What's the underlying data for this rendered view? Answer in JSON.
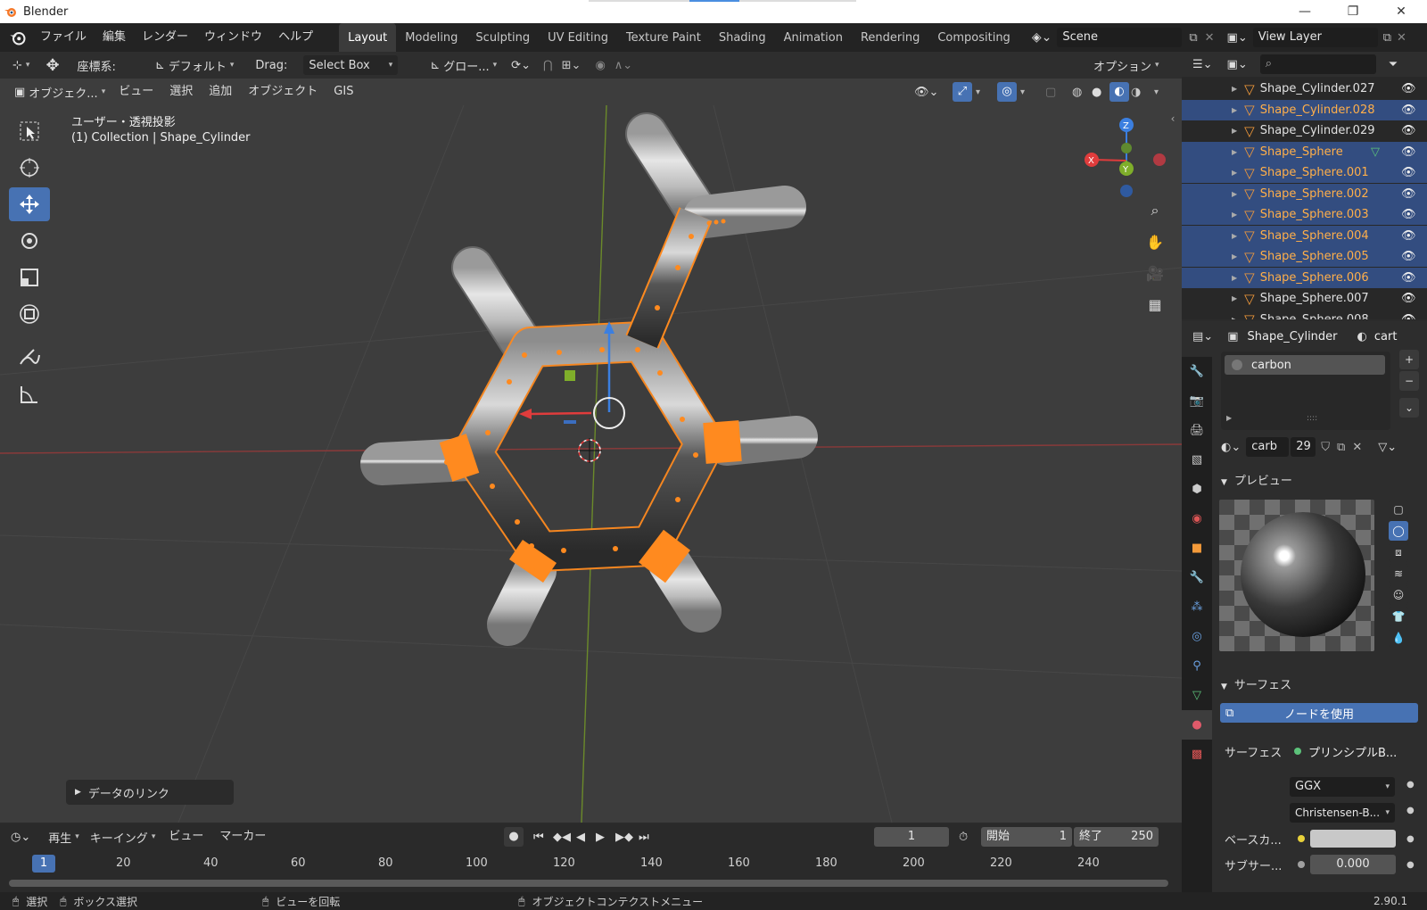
{
  "window": {
    "title": "Blender"
  },
  "menu": [
    "ファイル",
    "編集",
    "レンダー",
    "ウィンドウ",
    "ヘルプ"
  ],
  "workspaces": [
    {
      "label": "Layout",
      "active": true
    },
    {
      "label": "Modeling"
    },
    {
      "label": "Sculpting"
    },
    {
      "label": "UV Editing"
    },
    {
      "label": "Texture Paint"
    },
    {
      "label": "Shading"
    },
    {
      "label": "Animation"
    },
    {
      "label": "Rendering"
    },
    {
      "label": "Compositing"
    }
  ],
  "scene": {
    "name": "Scene"
  },
  "view_layer": {
    "name": "View Layer"
  },
  "header": {
    "coord_label": "座標系:",
    "coord_value": "デフォルト",
    "drag_label": "Drag:",
    "drag_value": "Select Box",
    "transform_value": "グロー...",
    "options_label": "オプション"
  },
  "viewport_menu": {
    "mode": "オブジェク...",
    "items": [
      "ビュー",
      "選択",
      "追加",
      "オブジェクト",
      "GIS"
    ]
  },
  "viewport": {
    "view_name": "ユーザー・透視投影",
    "collection": "(1) Collection | Shape_Cylinder",
    "link_panel": "データのリンク"
  },
  "outliner": {
    "items": [
      {
        "name": "Shape_Cylinder.027",
        "selected": false
      },
      {
        "name": "Shape_Cylinder.028",
        "selected": true
      },
      {
        "name": "Shape_Cylinder.029",
        "selected": false
      },
      {
        "name": "Shape_Sphere",
        "selected": true
      },
      {
        "name": "Shape_Sphere.001",
        "selected": true
      },
      {
        "name": "Shape_Sphere.002",
        "selected": true
      },
      {
        "name": "Shape_Sphere.003",
        "selected": true
      },
      {
        "name": "Shape_Sphere.004",
        "selected": true
      },
      {
        "name": "Shape_Sphere.005",
        "selected": true
      },
      {
        "name": "Shape_Sphere.006",
        "selected": true
      },
      {
        "name": "Shape_Sphere.007",
        "selected": false
      },
      {
        "name": "Shape_Sphere.008",
        "selected": false
      }
    ]
  },
  "properties": {
    "object_name": "Shape_Cylinder",
    "material_tab": "cart",
    "material_slot": "carbon",
    "material_name": "carb",
    "material_users": "29",
    "preview_label": "プレビュー",
    "surface_label": "サーフェス",
    "use_nodes": "ノードを使用",
    "surface_field_label": "サーフェス",
    "surface_value": "プリンシプルB...",
    "distribution": "GGX",
    "subsurface_method": "Christensen-B...",
    "base_color_label": "ベースカ...",
    "subsurface_label": "サブサー...",
    "subsurface_value": "0.000"
  },
  "timeline": {
    "menu": [
      "再生",
      "キーイング",
      "ビュー",
      "マーカー"
    ],
    "current_frame": "1",
    "start_label": "開始",
    "start_value": "1",
    "end_label": "終了",
    "end_value": "250",
    "ruler_current": "1",
    "ticks": [
      "20",
      "40",
      "60",
      "80",
      "100",
      "120",
      "140",
      "160",
      "180",
      "200",
      "220",
      "240"
    ]
  },
  "status": {
    "select": "選択",
    "box_select": "ボックス選択",
    "rotate_view": "ビューを回転",
    "context_menu": "オブジェクトコンテクストメニュー",
    "version": "2.90.1"
  },
  "colors": {
    "accent": "#4772b3",
    "selection": "#ff8a1f",
    "outliner_sel": "#334d80"
  }
}
